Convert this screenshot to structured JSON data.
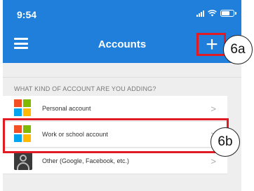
{
  "status_bar": {
    "time": "9:54"
  },
  "header": {
    "title": "Accounts",
    "add_label": "+"
  },
  "section_header": "WHAT KIND OF ACCOUNT ARE YOU ADDING?",
  "accounts": [
    {
      "label": "Personal account",
      "icon": "microsoft-logo-icon"
    },
    {
      "label": "Work or school account",
      "icon": "microsoft-logo-icon"
    },
    {
      "label": "Other (Google, Facebook, etc.)",
      "icon": "person-icon"
    }
  ],
  "chevron": ">",
  "callouts": {
    "a": "6a",
    "b": "6b"
  },
  "colors": {
    "header_blue": "#1f7fdb",
    "highlight_red": "#e01b24",
    "ms_red": "#f25022",
    "ms_green": "#7fba00",
    "ms_blue": "#00a4ef",
    "ms_yellow": "#ffb900"
  }
}
